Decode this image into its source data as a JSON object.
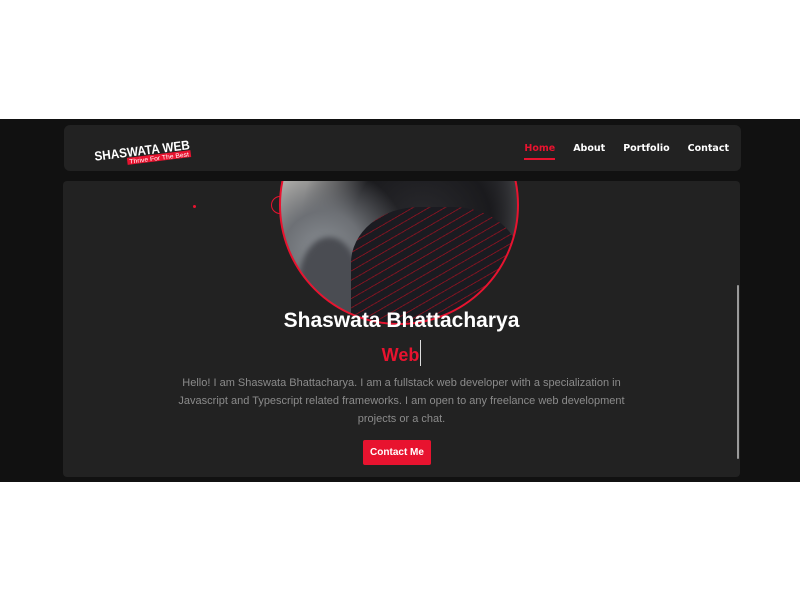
{
  "brand": {
    "logo_text": "SHASWATA WEB",
    "tagline": "Thrive For The Best",
    "accent_color": "#e8132f"
  },
  "nav": {
    "items": [
      {
        "label": "Home",
        "active": true
      },
      {
        "label": "About",
        "active": false
      },
      {
        "label": "Portfolio",
        "active": false
      },
      {
        "label": "Contact",
        "active": false
      }
    ]
  },
  "hero": {
    "name": "Shaswata Bhattacharya",
    "typed_text": "Web",
    "bio": "Hello! I am Shaswata Bhattacharya. I am a fullstack web developer with a specialization in Javascript and Typescript related frameworks. I am open to any freelance web development projects or a chat.",
    "cta_label": "Contact Me"
  }
}
